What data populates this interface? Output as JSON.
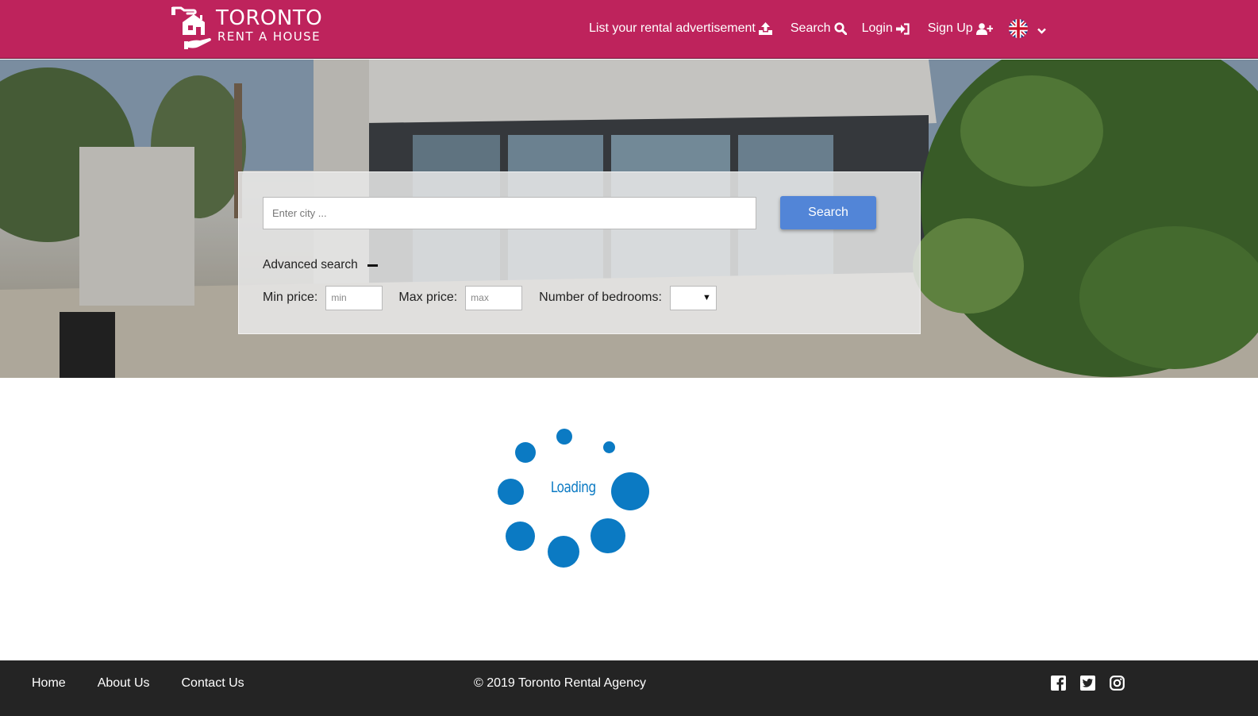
{
  "header": {
    "logo_title": "TORONTO",
    "logo_subtitle": "RENT A HOUSE",
    "brand_color": "#be235c",
    "nav": {
      "list_ad": "List your rental advertisement",
      "search": "Search",
      "login": "Login",
      "signup": "Sign Up"
    },
    "language_icon": "uk-flag-icon"
  },
  "search": {
    "city_placeholder": "Enter city ...",
    "button_label": "Search",
    "button_color": "#5285d7",
    "advanced_label": "Advanced search",
    "min_price_label": "Min price:",
    "min_placeholder": "min",
    "max_price_label": "Max price:",
    "max_placeholder": "max",
    "bedrooms_label": "Number of bedrooms:",
    "bedrooms_value": ""
  },
  "loader": {
    "text": "Loading",
    "color": "#0b7ac3"
  },
  "footer": {
    "links": [
      "Home",
      "About Us",
      "Contact Us"
    ],
    "copyright": "© 2019 Toronto Rental Agency",
    "social_icons": [
      "facebook-icon",
      "twitter-icon",
      "instagram-icon"
    ]
  }
}
